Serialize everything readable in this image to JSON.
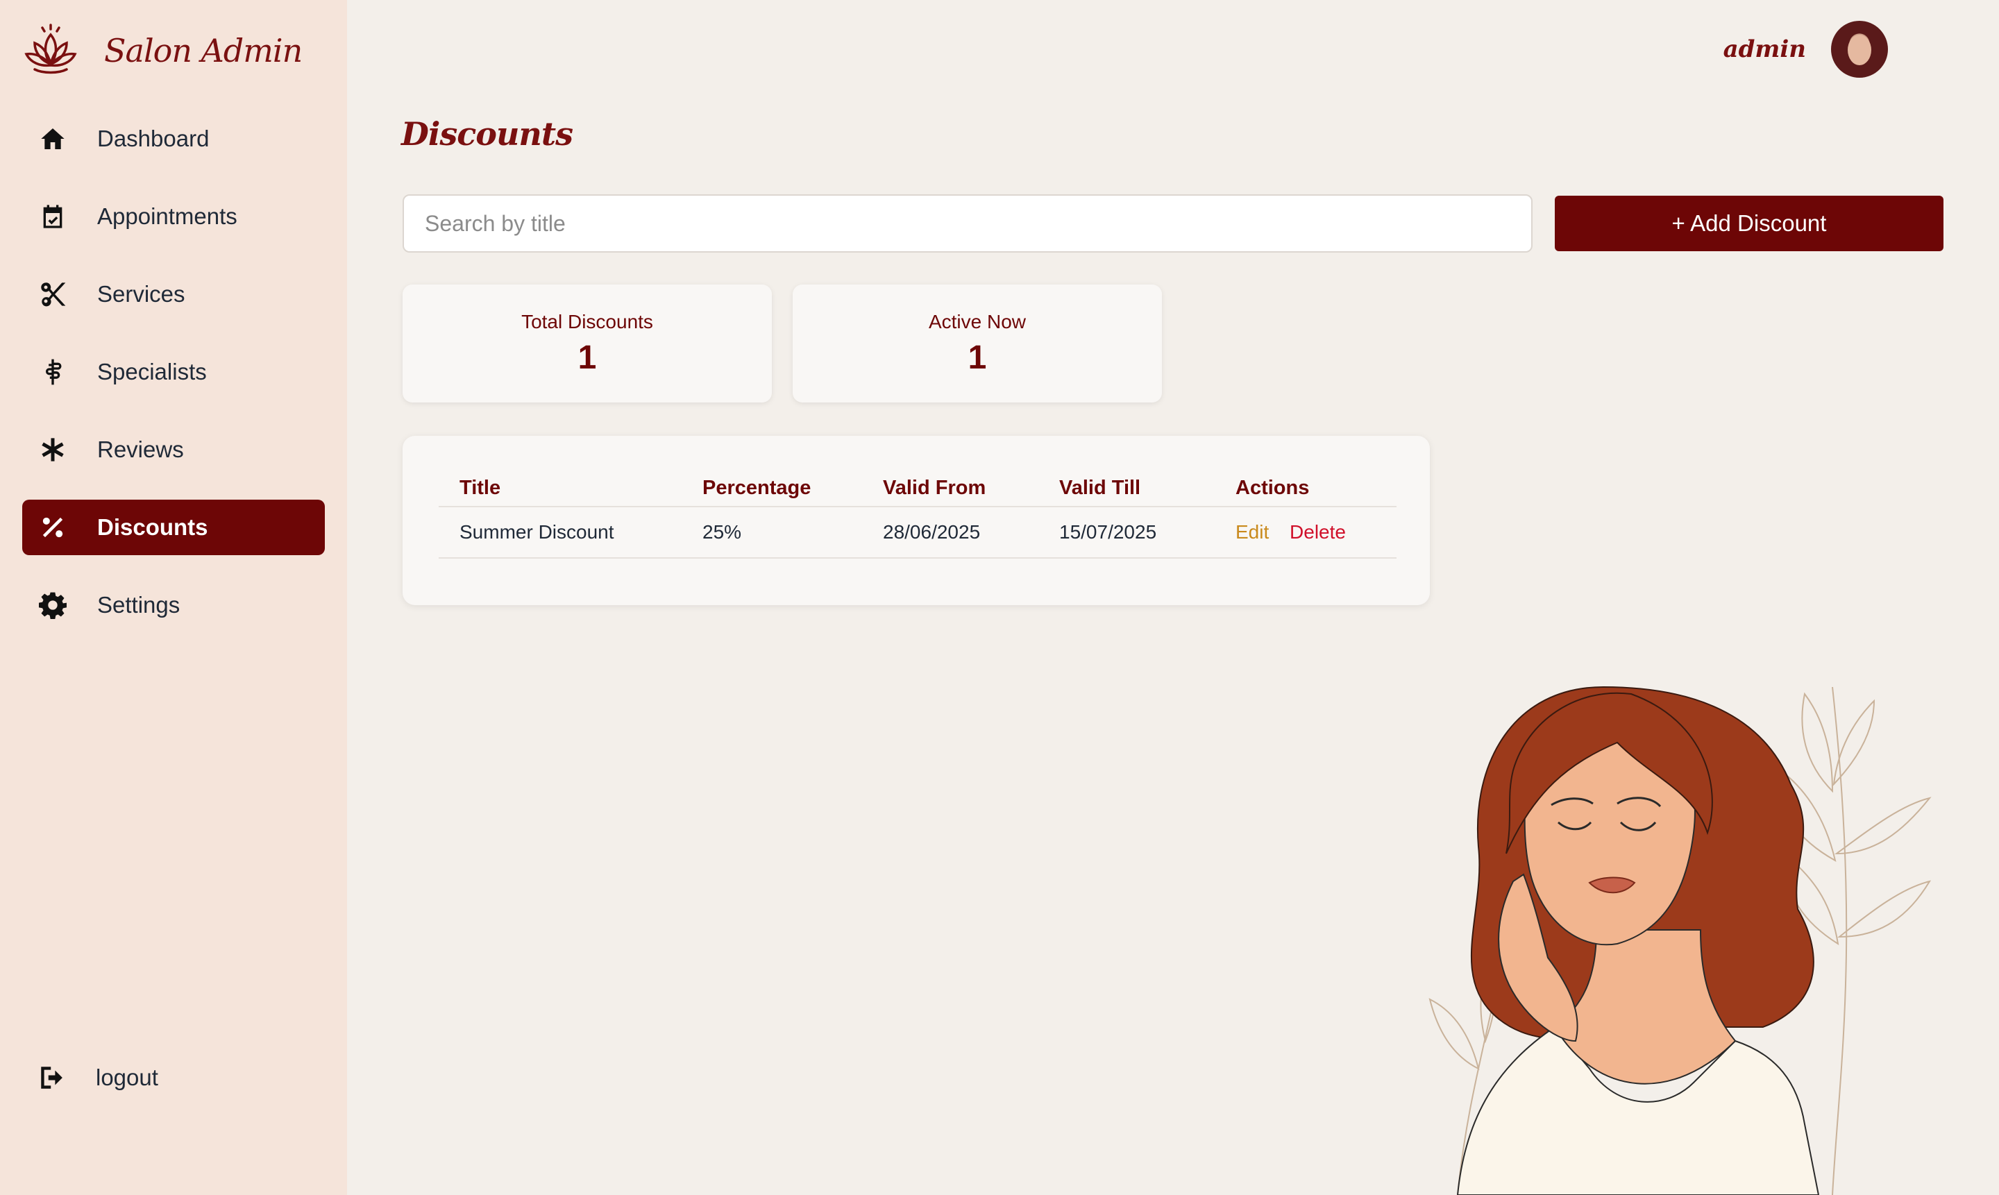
{
  "brand": {
    "name": "Salon Admin",
    "logo_icon": "lotus-icon"
  },
  "sidebar": {
    "items": [
      {
        "label": "Dashboard",
        "icon": "home-icon",
        "active": false
      },
      {
        "label": "Appointments",
        "icon": "calendar-check-icon",
        "active": false
      },
      {
        "label": "Services",
        "icon": "scissors-icon",
        "active": false
      },
      {
        "label": "Specialists",
        "icon": "staff-snake-icon",
        "active": false
      },
      {
        "label": "Reviews",
        "icon": "asterisk-icon",
        "active": false
      },
      {
        "label": "Discounts",
        "icon": "percent-icon",
        "active": true
      },
      {
        "label": "Settings",
        "icon": "gear-icon",
        "active": false
      }
    ],
    "logout_label": "logout"
  },
  "header": {
    "user_name": "admin"
  },
  "main": {
    "title": "Discounts",
    "search": {
      "placeholder": "Search by title",
      "value": ""
    },
    "add_button_label": "+ Add Discount",
    "stats": [
      {
        "label": "Total Discounts",
        "value": "1"
      },
      {
        "label": "Active Now",
        "value": "1"
      }
    ],
    "table": {
      "columns": [
        "Title",
        "Percentage",
        "Valid From",
        "Valid Till",
        "Actions"
      ],
      "rows": [
        {
          "title": "Summer Discount",
          "percentage": "25%",
          "valid_from": "28/06/2025",
          "valid_till": "15/07/2025",
          "edit_label": "Edit",
          "delete_label": "Delete"
        }
      ]
    }
  },
  "colors": {
    "accent": "#6d0606",
    "sidebar_bg": "#f5e4da",
    "page_bg": "#f3efea",
    "edit": "#c98a1d",
    "delete": "#d0102a"
  }
}
